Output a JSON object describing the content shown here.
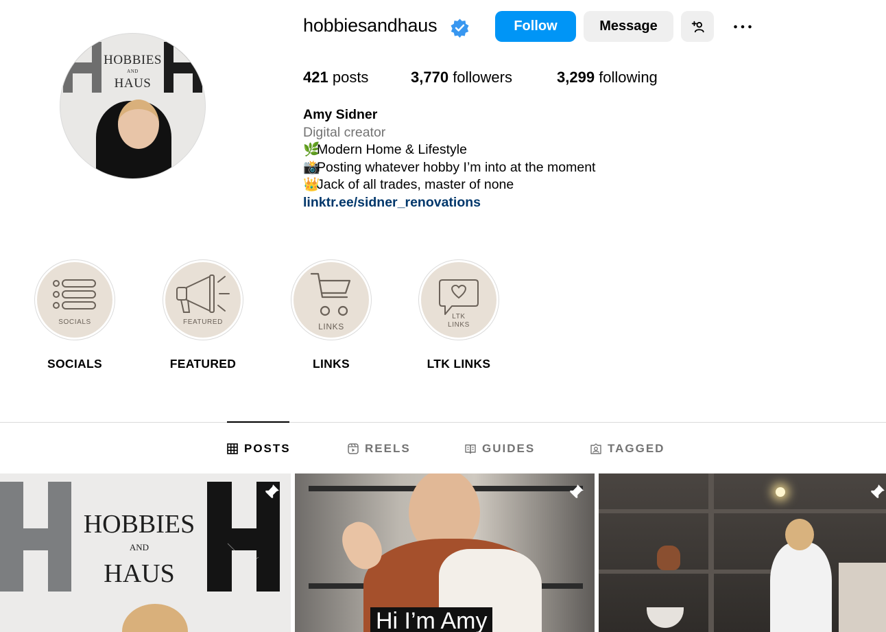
{
  "profile": {
    "username": "hobbiesandhaus",
    "avatar_logo_line1": "HOBBIES",
    "avatar_logo_and": "AND",
    "avatar_logo_line2": "HAUS"
  },
  "actions": {
    "follow_label": "Follow",
    "message_label": "Message",
    "add_icon": "person-add-icon",
    "more_icon": "more-options-icon"
  },
  "stats": {
    "posts_count": "421",
    "posts_label": "posts",
    "followers_count": "3,770",
    "followers_label": "followers",
    "following_count": "3,299",
    "following_label": "following"
  },
  "bio": {
    "name": "Amy Sidner",
    "category": "Digital creator",
    "line1_emoji": "🌿",
    "line1": "Modern Home & Lifestyle",
    "line2_emoji": "📸",
    "line2": "Posting whatever hobby I’m into at the moment",
    "line3_emoji": "👑",
    "line3": "Jack of all trades, master of none",
    "link": "linktr.ee/sidner_renovations"
  },
  "highlights": [
    {
      "title": "SOCIALS",
      "cover_text": "SOCIALS",
      "icon": "list-icon"
    },
    {
      "title": "FEATURED",
      "cover_text": "FEATURED",
      "icon": "megaphone-icon"
    },
    {
      "title": "LINKS",
      "cover_text": "LINKS",
      "icon": "cart-icon"
    },
    {
      "title": "LTK LINKS",
      "cover_text": "LTK LINKS",
      "cover_text_line1": "LTK",
      "cover_text_line2": "LINKS",
      "icon": "heart-bubble-icon"
    }
  ],
  "tabs": [
    {
      "label": "POSTS",
      "icon": "grid-icon",
      "active": true
    },
    {
      "label": "REELS",
      "icon": "reels-icon",
      "active": false
    },
    {
      "label": "GUIDES",
      "icon": "guides-icon",
      "active": false
    },
    {
      "label": "TAGGED",
      "icon": "tagged-icon",
      "active": false
    }
  ],
  "posts": [
    {
      "logo_line1": "HOBBIES",
      "logo_and": "AND",
      "logo_line2": "HAUS",
      "pinned": true
    },
    {
      "caption": "Hi I’m Amy",
      "pinned": true
    },
    {
      "pinned": true
    }
  ],
  "colors": {
    "follow_button": "#0095f6",
    "secondary_button": "#efefef",
    "link": "#00376b",
    "verified": "#3897f0",
    "highlight_cover": "#e8e0d6"
  }
}
